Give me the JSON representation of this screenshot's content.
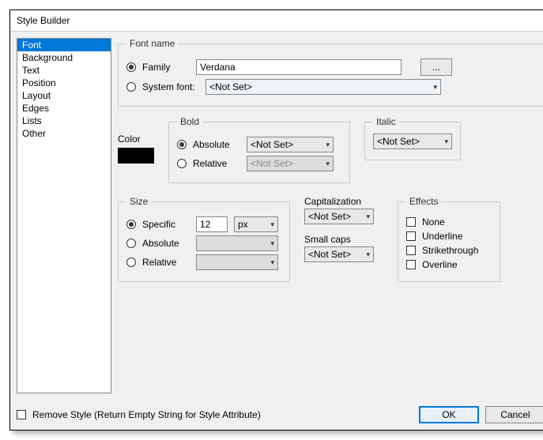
{
  "title": "Style Builder",
  "sidebar": {
    "items": [
      "Font",
      "Background",
      "Text",
      "Position",
      "Layout",
      "Edges",
      "Lists",
      "Other"
    ],
    "selected": 0
  },
  "fontName": {
    "legend": "Font name",
    "familyLabel": "Family",
    "familyValue": "Verdana",
    "browseLabel": "...",
    "systemLabel": "System font:",
    "systemValue": "<Not Set>"
  },
  "colorLabel": "Color",
  "bold": {
    "legend": "Bold",
    "absoluteLabel": "Absolute",
    "absoluteValue": "<Not Set>",
    "relativeLabel": "Relative",
    "relativeValue": "<Not Set>"
  },
  "italic": {
    "legend": "Italic",
    "value": "<Not Set>"
  },
  "size": {
    "legend": "Size",
    "specificLabel": "Specific",
    "specificValue": "12",
    "specificUnit": "px",
    "absoluteLabel": "Absolute",
    "relativeLabel": "Relative"
  },
  "caps": {
    "label": "Capitalization",
    "value": "<Not Set>"
  },
  "smallCaps": {
    "label": "Small caps",
    "value": "<Not Set>"
  },
  "effects": {
    "legend": "Effects",
    "none": "None",
    "underline": "Underline",
    "strike": "Strikethrough",
    "overline": "Overline"
  },
  "footer": {
    "removeStyle": "Remove Style (Return Empty String for Style Attribute)",
    "ok": "OK",
    "cancel": "Cancel"
  }
}
